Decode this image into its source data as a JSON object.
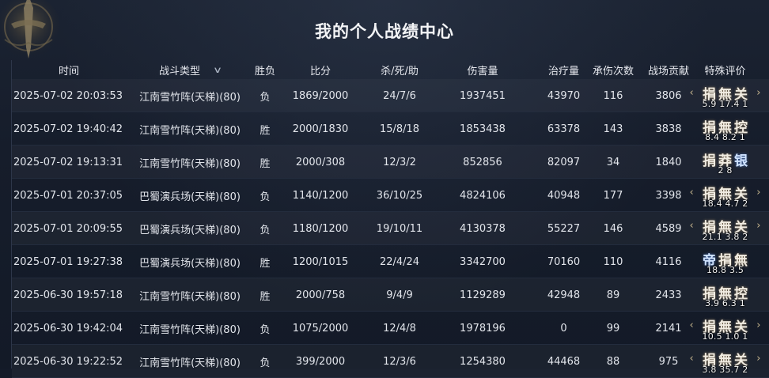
{
  "title": "我的个人战绩中心",
  "headers": {
    "time": "时间",
    "battle_type": "战斗类型",
    "result": "胜负",
    "score": "比分",
    "kda": "杀/死/助",
    "damage": "伤害量",
    "healing": "治疗量",
    "damage_taken": "承伤次数",
    "contribution": "战场贡献",
    "special": "特殊评价"
  },
  "rows": [
    {
      "time": "2025-07-02  20:03:53",
      "type": "江南雪竹阵(天梯)(80)",
      "result": "负",
      "score": "1869/2000",
      "kda": "24/7/6",
      "damage": "1937451",
      "healing": "43970",
      "taken": "116",
      "contrib": "3806",
      "eval_chars": [
        "捐",
        "無",
        "关"
      ],
      "eval_nums": "5.9  17.4  1",
      "wings": true
    },
    {
      "time": "2025-07-02  19:40:42",
      "type": "江南雪竹阵(天梯)(80)",
      "result": "胜",
      "score": "2000/1830",
      "kda": "15/8/18",
      "damage": "1853438",
      "healing": "63378",
      "taken": "143",
      "contrib": "3838",
      "eval_chars": [
        "捐",
        "無",
        "控"
      ],
      "eval_nums": "8.4  8.2  1",
      "wings": false
    },
    {
      "time": "2025-07-02  19:13:31",
      "type": "江南雪竹阵(天梯)(80)",
      "result": "胜",
      "score": "2000/308",
      "kda": "12/3/2",
      "damage": "852856",
      "healing": "82097",
      "taken": "34",
      "contrib": "1840",
      "eval_chars": [
        "捐",
        "莽",
        "银"
      ],
      "eval_nums": "2  8",
      "wings": false
    },
    {
      "time": "2025-07-01  20:37:05",
      "type": "巴蜀演兵场(天梯)(80)",
      "result": "负",
      "score": "1140/1200",
      "kda": "36/10/25",
      "damage": "4824106",
      "healing": "40948",
      "taken": "177",
      "contrib": "3398",
      "eval_chars": [
        "捐",
        "無",
        "关"
      ],
      "eval_nums": "18.4  4.7  2",
      "wings": true
    },
    {
      "time": "2025-07-01  20:09:55",
      "type": "巴蜀演兵场(天梯)(80)",
      "result": "负",
      "score": "1180/1200",
      "kda": "19/10/11",
      "damage": "4130378",
      "healing": "55227",
      "taken": "146",
      "contrib": "4589",
      "eval_chars": [
        "捐",
        "無",
        "关"
      ],
      "eval_nums": "21.1  3.8  2",
      "wings": true
    },
    {
      "time": "2025-07-01  19:27:38",
      "type": "巴蜀演兵场(天梯)(80)",
      "result": "胜",
      "score": "1200/1015",
      "kda": "22/4/24",
      "damage": "3342700",
      "healing": "70160",
      "taken": "110",
      "contrib": "4116",
      "eval_chars": [
        "帝",
        "捐",
        "無"
      ],
      "eval_nums": "18.8  3.5",
      "wings": false
    },
    {
      "time": "2025-06-30  19:57:18",
      "type": "江南雪竹阵(天梯)(80)",
      "result": "胜",
      "score": "2000/758",
      "kda": "9/4/9",
      "damage": "1129289",
      "healing": "42948",
      "taken": "89",
      "contrib": "2433",
      "eval_chars": [
        "捐",
        "無",
        "控"
      ],
      "eval_nums": "3.9  6.3  1",
      "wings": false
    },
    {
      "time": "2025-06-30  19:42:04",
      "type": "江南雪竹阵(天梯)(80)",
      "result": "负",
      "score": "1075/2000",
      "kda": "12/4/8",
      "damage": "1978196",
      "healing": "0",
      "taken": "99",
      "contrib": "2141",
      "eval_chars": [
        "捐",
        "無",
        "关"
      ],
      "eval_nums": "10.5  1.0  1",
      "wings": true
    },
    {
      "time": "2025-06-30  19:22:52",
      "type": "江南雪竹阵(天梯)(80)",
      "result": "负",
      "score": "399/2000",
      "kda": "12/3/6",
      "damage": "1254380",
      "healing": "44468",
      "taken": "88",
      "contrib": "975",
      "eval_chars": [
        "捐",
        "無",
        "关"
      ],
      "eval_nums": "3.8  35.7  2",
      "wings": true
    }
  ],
  "icons": {
    "sort": "chevron-down-icon",
    "emblem": "sword-emblem-icon"
  },
  "colors": {
    "background": "#141b29",
    "text": "#dfe3ea",
    "badge_text": "#f1ece2"
  }
}
